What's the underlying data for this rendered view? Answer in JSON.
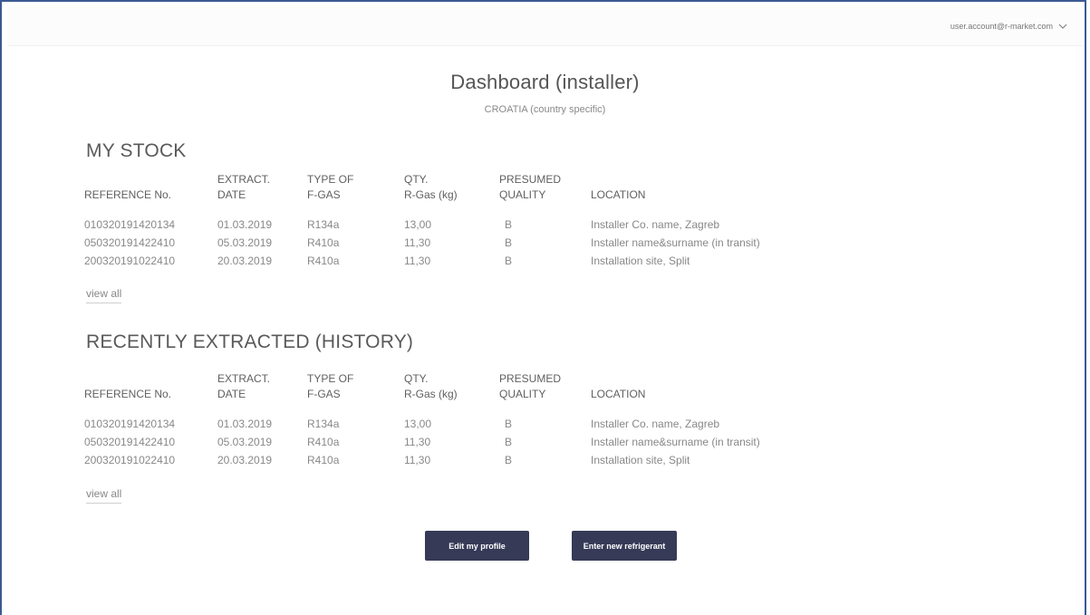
{
  "header": {
    "account_email": "user.account@r-market.com",
    "account_menu_icon": "chevron-down-icon"
  },
  "page": {
    "title": "Dashboard (installer)",
    "subtitle": "CROATIA (country specific)"
  },
  "columns": {
    "reference_l1": "",
    "reference_l2": "REFERENCE No.",
    "date_l1": "EXTRACT.",
    "date_l2": "DATE",
    "type_l1": "TYPE OF",
    "type_l2": "F-GAS",
    "qty_l1": "QTY.",
    "qty_l2": "R-Gas (kg)",
    "quality_l1": "PRESUMED",
    "quality_l2": "QUALITY",
    "location_l1": "",
    "location_l2": "LOCATION"
  },
  "my_stock": {
    "title": "MY STOCK",
    "rows": [
      {
        "ref": "010320191420134",
        "date": "01.03.2019",
        "type": "R134a",
        "qty": "13,00",
        "quality": "B",
        "location": "Installer Co. name, Zagreb"
      },
      {
        "ref": "050320191422410",
        "date": "05.03.2019",
        "type": "R410a",
        "qty": "11,30",
        "quality": "B",
        "location": "Installer name&surname (in transit)"
      },
      {
        "ref": "200320191022410",
        "date": "20.03.2019",
        "type": "R410a",
        "qty": "11,30",
        "quality": "B",
        "location": "Installation site, Split"
      }
    ],
    "view_all": "view all"
  },
  "history": {
    "title": "RECENTLY EXTRACTED (HISTORY)",
    "rows": [
      {
        "ref": "010320191420134",
        "date": "01.03.2019",
        "type": "R134a",
        "qty": "13,00",
        "quality": "B",
        "location": "Installer Co. name, Zagreb"
      },
      {
        "ref": "050320191422410",
        "date": "05.03.2019",
        "type": "R410a",
        "qty": "11,30",
        "quality": "B",
        "location": "Installer name&surname (in transit)"
      },
      {
        "ref": "200320191022410",
        "date": "20.03.2019",
        "type": "R410a",
        "qty": "11,30",
        "quality": "B",
        "location": "Installation site, Split"
      }
    ],
    "view_all": "view all"
  },
  "actions": {
    "edit_profile": "Edit my profile",
    "enter_refrigerant": "Enter new refrigerant"
  },
  "colors": {
    "button_bg": "#363a57",
    "frame_border": "#3a5a92"
  }
}
